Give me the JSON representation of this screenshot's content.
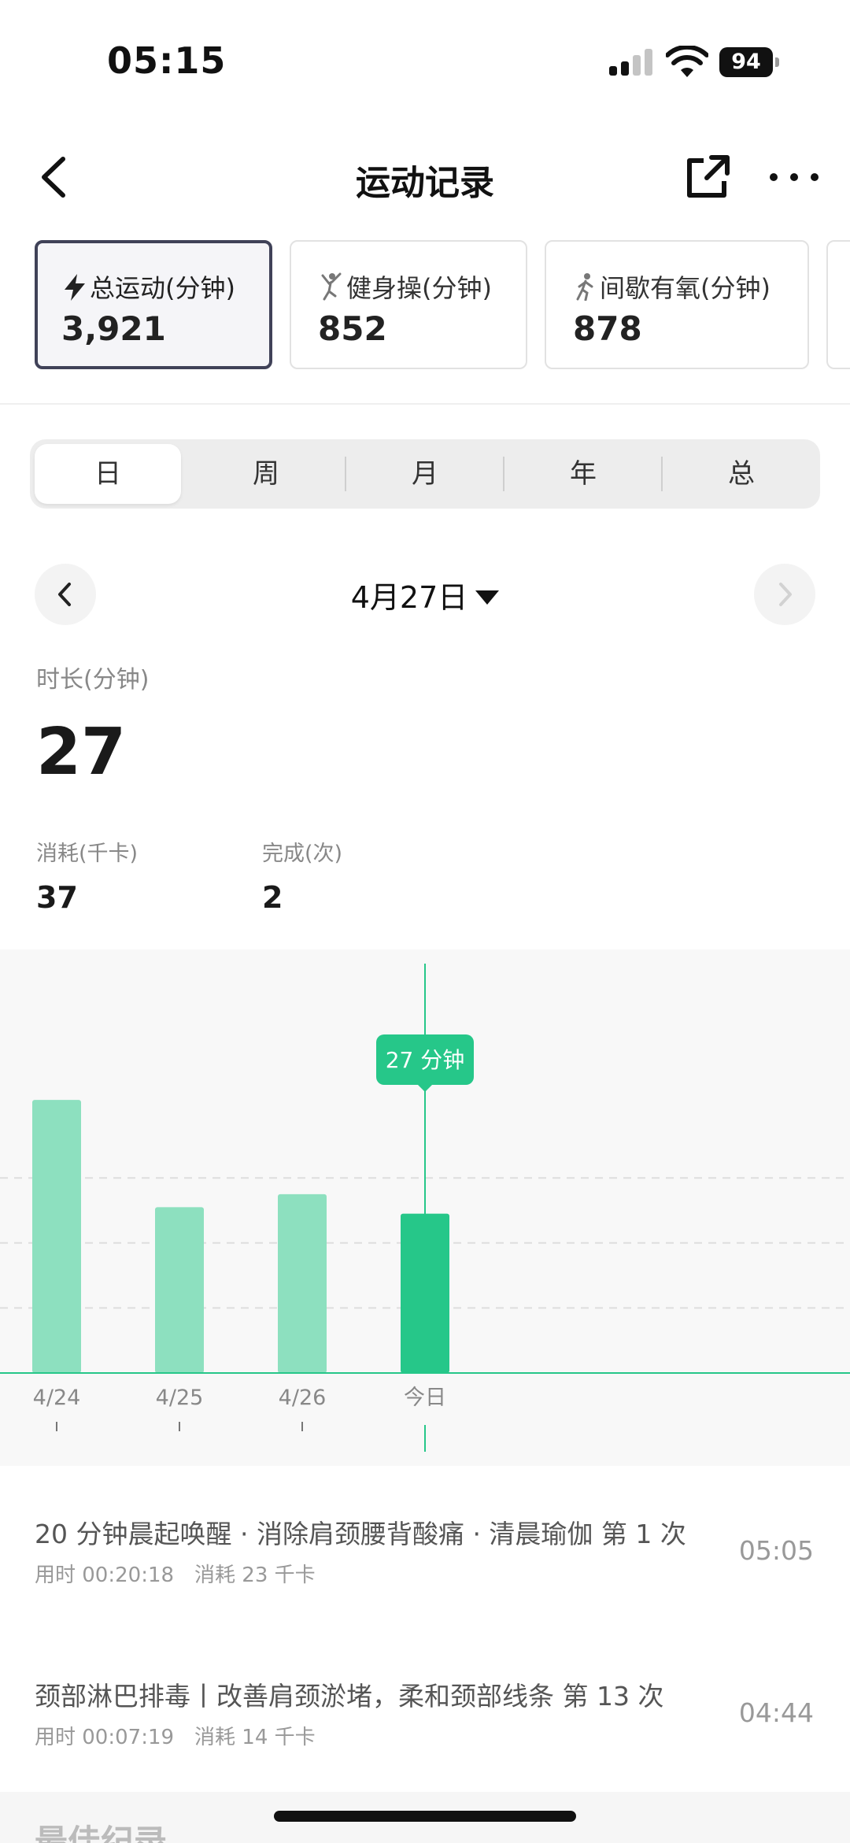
{
  "status": {
    "time": "05:15",
    "battery": "94"
  },
  "nav": {
    "title": "运动记录"
  },
  "categories": [
    {
      "label": "总运动(分钟)",
      "value": "3,921",
      "icon": "bolt-icon",
      "active": true
    },
    {
      "label": "健身操(分钟)",
      "value": "852",
      "icon": "aerobics-icon",
      "active": false
    },
    {
      "label": "间歇有氧(分钟)",
      "value": "878",
      "icon": "running-icon",
      "active": false
    }
  ],
  "tabs": [
    "日",
    "周",
    "月",
    "年",
    "总"
  ],
  "date": {
    "label": "4月27日"
  },
  "stats": {
    "duration_label": "时长(分钟)",
    "duration_value": "27",
    "calories_label": "消耗(千卡)",
    "calories_value": "37",
    "count_label": "完成(次)",
    "count_value": "2"
  },
  "chart_data": {
    "type": "bar",
    "categories": [
      "4/24",
      "4/25",
      "4/26",
      "今日"
    ],
    "values": [
      42,
      25.5,
      27.5,
      24.5
    ],
    "highlight_index": 3,
    "tooltip": "27 分钟",
    "ylim": [
      0,
      50
    ],
    "colors": {
      "bar": "#8de0bf",
      "active": "#26c789"
    }
  },
  "records": [
    {
      "title": "20 分钟晨起唤醒 · 消除肩颈腰背酸痛 · 清晨瑜伽  第 1 次",
      "duration": "用时 00:20:18",
      "calories": "消耗 23 千卡",
      "time": "05:05"
    },
    {
      "title": "颈部淋巴排毒丨改善肩颈淤堵，柔和颈部线条  第 13 次",
      "duration": "用时 00:07:19",
      "calories": "消耗 14 千卡",
      "time": "04:44"
    }
  ],
  "best": {
    "title": "最佳纪录"
  }
}
